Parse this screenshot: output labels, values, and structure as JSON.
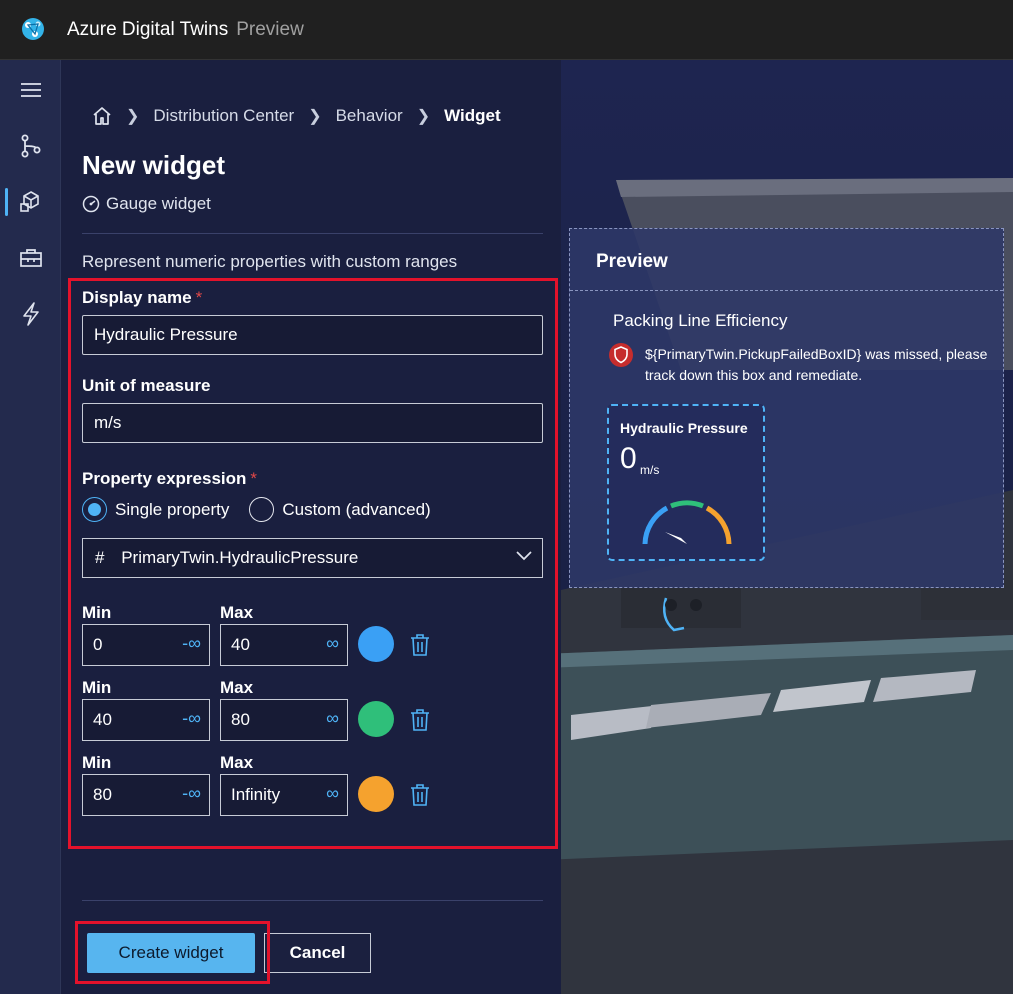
{
  "app": {
    "title": "Azure Digital Twins",
    "subtitle": "Preview"
  },
  "rail": {
    "items": [
      {
        "icon": "menu-icon"
      },
      {
        "icon": "graph-icon"
      },
      {
        "icon": "scene-builder-icon",
        "active": true
      },
      {
        "icon": "toolbox-icon"
      },
      {
        "icon": "lightning-icon"
      }
    ]
  },
  "breadcrumb": {
    "home_icon": "home-icon",
    "items": [
      "Distribution Center",
      "Behavior",
      "Widget"
    ]
  },
  "page": {
    "title": "New widget",
    "widget_type": "Gauge widget",
    "description": "Represent numeric properties with custom ranges"
  },
  "form": {
    "display_name": {
      "label": "Display name",
      "required_mark": "*",
      "value": "Hydraulic Pressure"
    },
    "unit": {
      "label": "Unit of measure",
      "value": "m/s"
    },
    "expression": {
      "label": "Property expression",
      "required_mark": "*",
      "options": [
        "Single property",
        "Custom (advanced)"
      ],
      "selected": "Single property",
      "property_hash": "#",
      "property": "PrimaryTwin.HydraulicPressure"
    },
    "ranges": [
      {
        "min_label": "Min",
        "max_label": "Max",
        "min": "0",
        "max": "40",
        "min_inf": "-∞",
        "max_inf": "∞",
        "color": "#3aa0f5"
      },
      {
        "min_label": "Min",
        "max_label": "Max",
        "min": "40",
        "max": "80",
        "min_inf": "-∞",
        "max_inf": "∞",
        "color": "#2fbf7a"
      },
      {
        "min_label": "Min",
        "max_label": "Max",
        "min": "80",
        "max": "Infinity",
        "min_inf": "-∞",
        "max_inf": "∞",
        "color": "#f5a22e"
      }
    ]
  },
  "buttons": {
    "create": "Create widget",
    "cancel": "Cancel"
  },
  "preview": {
    "title": "Preview",
    "card_title": "Packing Line Efficiency",
    "alert_text": "${PrimaryTwin.PickupFailedBoxID} was missed, please track down this box and remediate.",
    "gauge": {
      "title": "Hydraulic Pressure",
      "value": "0",
      "unit": "m/s"
    }
  },
  "colors": {
    "accent": "#4fb3f6",
    "highlight": "#e3122b"
  }
}
